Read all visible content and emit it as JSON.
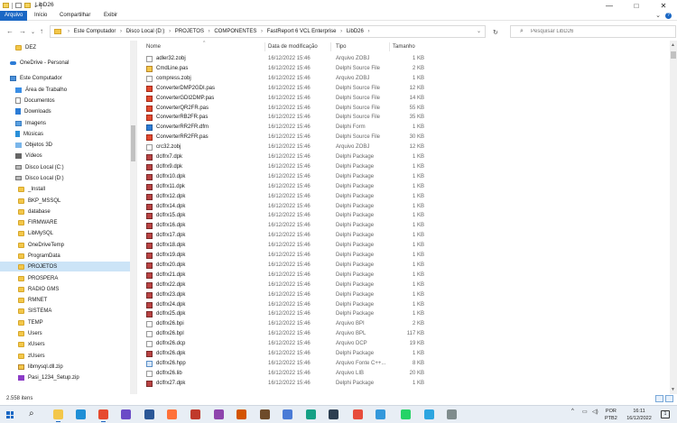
{
  "window": {
    "title": "LibD26",
    "controls": {
      "minimize": "—",
      "maximize": "□",
      "close": "✕"
    }
  },
  "ribbon": {
    "tabs": [
      "Arquivo",
      "Início",
      "Compartilhar",
      "Exibir"
    ],
    "active_tab": "Arquivo",
    "help": "?",
    "collapse": "⌄"
  },
  "address_bar": {
    "nav": {
      "back": "←",
      "forward": "→",
      "recent": "⌄",
      "up": "↑"
    },
    "breadcrumbs": [
      "Este Computador",
      "Disco Local (D:)",
      "PROJETOS",
      "COMPONENTES",
      "FastReport 6 VCL Enterprise",
      "LibD26"
    ],
    "separator": "›",
    "dropdown": "⌄",
    "refresh": "↻"
  },
  "search": {
    "placeholder": "Pesquisar LibD26",
    "icon": "search-icon"
  },
  "sidebar": {
    "items": [
      {
        "label": "DEZ",
        "icon": "folder-icon",
        "indent": 1
      },
      {
        "label": "OneDrive - Personal",
        "icon": "cloud-icon",
        "indent": 0
      },
      {
        "label": "Este Computador",
        "icon": "pc-icon",
        "indent": 0
      },
      {
        "label": "Área de Trabalho",
        "icon": "desktop-icon",
        "indent": 1
      },
      {
        "label": "Documentos",
        "icon": "documents-icon",
        "indent": 1
      },
      {
        "label": "Downloads",
        "icon": "download-icon",
        "indent": 1
      },
      {
        "label": "Imagens",
        "icon": "images-icon",
        "indent": 1
      },
      {
        "label": "Músicas",
        "icon": "music-icon",
        "indent": 1
      },
      {
        "label": "Objetos 3D",
        "icon": "objects3d-icon",
        "indent": 1
      },
      {
        "label": "Vídeos",
        "icon": "video-icon",
        "indent": 1
      },
      {
        "label": "Disco Local (C:)",
        "icon": "disk-icon",
        "indent": 1
      },
      {
        "label": "Disco Local (D:)",
        "icon": "disk-icon",
        "indent": 1
      },
      {
        "label": "_Install",
        "icon": "folder-icon",
        "indent": 2
      },
      {
        "label": "BKP_MSSQL",
        "icon": "folder-icon",
        "indent": 2
      },
      {
        "label": "database",
        "icon": "folder-icon",
        "indent": 2
      },
      {
        "label": "FIRMWARE",
        "icon": "folder-icon",
        "indent": 2
      },
      {
        "label": "LibMySQL",
        "icon": "folder-icon",
        "indent": 2
      },
      {
        "label": "OneDriveTemp",
        "icon": "folder-icon",
        "indent": 2
      },
      {
        "label": "ProgramData",
        "icon": "folder-icon",
        "indent": 2
      },
      {
        "label": "PROJETOS",
        "icon": "folder-icon",
        "indent": 2,
        "selected": true
      },
      {
        "label": "PROSPERA",
        "icon": "folder-icon",
        "indent": 2
      },
      {
        "label": "RADIO GMS",
        "icon": "folder-icon",
        "indent": 2
      },
      {
        "label": "RMNET",
        "icon": "folder-icon",
        "indent": 2
      },
      {
        "label": "SISTEMA",
        "icon": "folder-icon",
        "indent": 2
      },
      {
        "label": "TEMP",
        "icon": "folder-icon",
        "indent": 2
      },
      {
        "label": "Users",
        "icon": "folder-icon",
        "indent": 2
      },
      {
        "label": "xUsers",
        "icon": "folder-icon",
        "indent": 2
      },
      {
        "label": "zUsers",
        "icon": "folder-icon",
        "indent": 2
      },
      {
        "label": "libmysql.dll.zip",
        "icon": "zip-icon",
        "indent": 2
      },
      {
        "label": "Pasi_1234_Setup.zip",
        "icon": "setup-zip-icon",
        "indent": 2
      }
    ]
  },
  "columns": {
    "name": "Nome",
    "date": "Data de modificação",
    "type": "Tipo",
    "size": "Tamanho",
    "sort_indicator": "^"
  },
  "files": [
    {
      "name": "adler32.zobj",
      "date": "16/12/2022 15:46",
      "type": "Arquivo ZOBJ",
      "size": "1 KB",
      "icon": "zobj"
    },
    {
      "name": "CmdLine.pas",
      "date": "16/12/2022 15:46",
      "type": "Delphi Source File",
      "size": "2 KB",
      "icon": "cmd"
    },
    {
      "name": "compress.zobj",
      "date": "16/12/2022 15:46",
      "type": "Arquivo ZOBJ",
      "size": "1 KB",
      "icon": "zobj"
    },
    {
      "name": "ConverterDMP2GDI.pas",
      "date": "16/12/2022 15:46",
      "type": "Delphi Source File",
      "size": "12 KB",
      "icon": "pas"
    },
    {
      "name": "ConverterGDI2DMP.pas",
      "date": "16/12/2022 15:46",
      "type": "Delphi Source File",
      "size": "14 KB",
      "icon": "pas"
    },
    {
      "name": "ConverterQR2FR.pas",
      "date": "16/12/2022 15:46",
      "type": "Delphi Source File",
      "size": "55 KB",
      "icon": "pas"
    },
    {
      "name": "ConverterRB2FR.pas",
      "date": "16/12/2022 15:46",
      "type": "Delphi Source File",
      "size": "35 KB",
      "icon": "pas"
    },
    {
      "name": "ConverterRR2FR.dfm",
      "date": "16/12/2022 15:46",
      "type": "Delphi Form",
      "size": "1 KB",
      "icon": "form"
    },
    {
      "name": "ConverterRR2FR.pas",
      "date": "16/12/2022 15:46",
      "type": "Delphi Source File",
      "size": "30 KB",
      "icon": "pas"
    },
    {
      "name": "crc32.zobj",
      "date": "16/12/2022 15:46",
      "type": "Arquivo ZOBJ",
      "size": "12 KB",
      "icon": "zobj"
    },
    {
      "name": "dclfrx7.dpk",
      "date": "16/12/2022 15:46",
      "type": "Delphi Package",
      "size": "1 KB",
      "icon": "pkg"
    },
    {
      "name": "dclfrx9.dpk",
      "date": "16/12/2022 15:46",
      "type": "Delphi Package",
      "size": "1 KB",
      "icon": "pkg"
    },
    {
      "name": "dclfrx10.dpk",
      "date": "16/12/2022 15:46",
      "type": "Delphi Package",
      "size": "1 KB",
      "icon": "pkg"
    },
    {
      "name": "dclfrx11.dpk",
      "date": "16/12/2022 15:46",
      "type": "Delphi Package",
      "size": "1 KB",
      "icon": "pkg"
    },
    {
      "name": "dclfrx12.dpk",
      "date": "16/12/2022 15:46",
      "type": "Delphi Package",
      "size": "1 KB",
      "icon": "pkg"
    },
    {
      "name": "dclfrx14.dpk",
      "date": "16/12/2022 15:46",
      "type": "Delphi Package",
      "size": "1 KB",
      "icon": "pkg"
    },
    {
      "name": "dclfrx15.dpk",
      "date": "16/12/2022 15:46",
      "type": "Delphi Package",
      "size": "1 KB",
      "icon": "pkg"
    },
    {
      "name": "dclfrx16.dpk",
      "date": "16/12/2022 15:46",
      "type": "Delphi Package",
      "size": "1 KB",
      "icon": "pkg"
    },
    {
      "name": "dclfrx17.dpk",
      "date": "16/12/2022 15:46",
      "type": "Delphi Package",
      "size": "1 KB",
      "icon": "pkg"
    },
    {
      "name": "dclfrx18.dpk",
      "date": "16/12/2022 15:46",
      "type": "Delphi Package",
      "size": "1 KB",
      "icon": "pkg"
    },
    {
      "name": "dclfrx19.dpk",
      "date": "16/12/2022 15:46",
      "type": "Delphi Package",
      "size": "1 KB",
      "icon": "pkg"
    },
    {
      "name": "dclfrx20.dpk",
      "date": "16/12/2022 15:46",
      "type": "Delphi Package",
      "size": "1 KB",
      "icon": "pkg"
    },
    {
      "name": "dclfrx21.dpk",
      "date": "16/12/2022 15:46",
      "type": "Delphi Package",
      "size": "1 KB",
      "icon": "pkg"
    },
    {
      "name": "dclfrx22.dpk",
      "date": "16/12/2022 15:46",
      "type": "Delphi Package",
      "size": "1 KB",
      "icon": "pkg"
    },
    {
      "name": "dclfrx23.dpk",
      "date": "16/12/2022 15:46",
      "type": "Delphi Package",
      "size": "1 KB",
      "icon": "pkg"
    },
    {
      "name": "dclfrx24.dpk",
      "date": "16/12/2022 15:46",
      "type": "Delphi Package",
      "size": "1 KB",
      "icon": "pkg"
    },
    {
      "name": "dclfrx25.dpk",
      "date": "16/12/2022 15:46",
      "type": "Delphi Package",
      "size": "1 KB",
      "icon": "pkg"
    },
    {
      "name": "dclfrx26.bpi",
      "date": "16/12/2022 15:46",
      "type": "Arquivo BPI",
      "size": "2 KB",
      "icon": "blank"
    },
    {
      "name": "dclfrx26.bpl",
      "date": "16/12/2022 15:46",
      "type": "Arquivo BPL",
      "size": "117 KB",
      "icon": "blank"
    },
    {
      "name": "dclfrx26.dcp",
      "date": "16/12/2022 15:46",
      "type": "Arquivo DCP",
      "size": "19 KB",
      "icon": "blank"
    },
    {
      "name": "dclfrx26.dpk",
      "date": "16/12/2022 15:46",
      "type": "Delphi Package",
      "size": "1 KB",
      "icon": "pkg"
    },
    {
      "name": "dclfrx26.hpp",
      "date": "16/12/2022 15:46",
      "type": "Arquivo Fonte C++...",
      "size": "8 KB",
      "icon": "cpp"
    },
    {
      "name": "dclfrx26.lib",
      "date": "16/12/2022 15:46",
      "type": "Arquivo LIB",
      "size": "20 KB",
      "icon": "blank"
    },
    {
      "name": "dclfrx27.dpk",
      "date": "16/12/2022 15:46",
      "type": "Delphi Package",
      "size": "1 KB",
      "icon": "pkg"
    }
  ],
  "status": {
    "item_count": "2.558 itens"
  },
  "taskbar": {
    "tray_arrow": "^",
    "language": "POR",
    "layout": "PTB2",
    "time": "16:11",
    "date": "16/12/2022",
    "apps": [
      "search-icon",
      "file-explorer-icon",
      "edge-icon",
      "chrome-icon",
      "app-icon",
      "word-icon",
      "firefox-icon",
      "app-icon",
      "app-icon",
      "app-icon",
      "app-icon",
      "app-icon",
      "app-icon",
      "app-icon",
      "app-icon",
      "app-icon",
      "vscode-icon",
      "whatsapp-icon",
      "telegram-icon",
      "app-icon"
    ],
    "colors": [
      "#2a6ad1",
      "#f3c74a",
      "#1f8fd6",
      "#e64a2f",
      "#6b4bc7",
      "#2b5797",
      "#ff7139",
      "#c0392b",
      "#8e44ad",
      "#d35400",
      "#6e4b2a",
      "#4a7bd6",
      "#16a085",
      "#2c3e50",
      "#e74c3c",
      "#3498db",
      "#0078d4",
      "#25d366",
      "#2ca5e0",
      "#7f8c8d"
    ]
  }
}
